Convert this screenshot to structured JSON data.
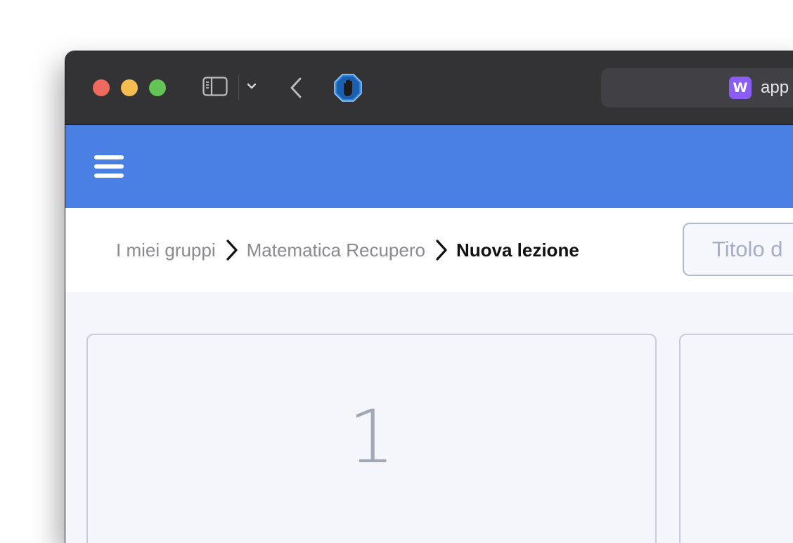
{
  "browser": {
    "url_text": "app",
    "favicon_letter": "W",
    "favicon_color": "#8b5cf6",
    "titlebar_color": "#333336"
  },
  "app": {
    "header_color": "#4a7fe4",
    "menu_icon": "hamburger-menu-icon"
  },
  "breadcrumb": {
    "items": [
      {
        "label": "I miei gruppi"
      },
      {
        "label": "Matematica Recupero"
      },
      {
        "label": "Nuova lezione"
      }
    ]
  },
  "title_field": {
    "placeholder": "Titolo d",
    "value": ""
  },
  "cards": [
    {
      "number": "1"
    },
    {
      "number": ""
    }
  ]
}
